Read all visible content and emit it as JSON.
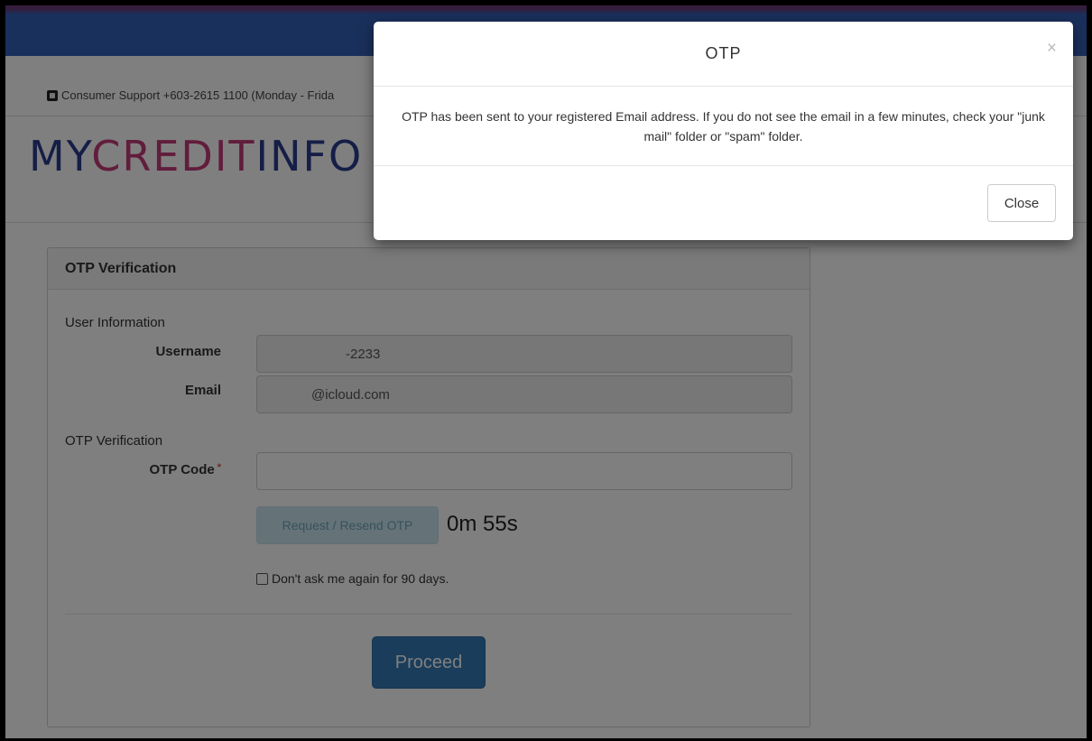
{
  "header": {
    "support_text": "Consumer Support +603-2615 1100 (Monday - Frida",
    "logo": {
      "part1": "MY",
      "part2": "CREDIT",
      "part3": "INFO"
    }
  },
  "panel": {
    "title": "OTP Verification",
    "user_info_title": "User Information",
    "username_label": "Username",
    "username_value": "-2233",
    "email_label": "Email",
    "email_value": "@icloud.com",
    "otp_section_title": "OTP Verification",
    "otp_code_label": "OTP Code",
    "required_mark": "*",
    "otp_code_value": "",
    "resend_button": "Request / Resend OTP",
    "timer": "0m 55s",
    "dont_ask_label": "Don't ask me again for 90 days.",
    "proceed_button": "Proceed"
  },
  "modal": {
    "title": "OTP",
    "close_x": "×",
    "message": "OTP has been sent to your registered Email address. If you do not see the email in a few minutes, check your \"junk mail\" folder or \"spam\" folder.",
    "close_button": "Close"
  },
  "colors": {
    "topbar": "#3461b8",
    "logo_blue": "#2b3c8f",
    "logo_pink": "#c23b78",
    "primary_button": "#337ab7"
  }
}
